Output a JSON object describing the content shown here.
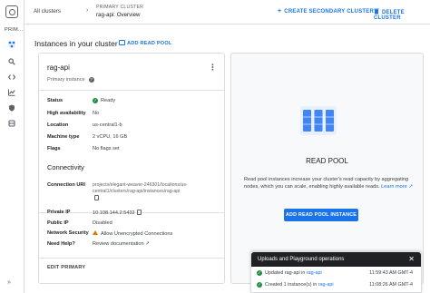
{
  "rail": {
    "section_label": "PRIM...",
    "icons": [
      "overview-icon",
      "query-icon",
      "code-icon",
      "monitoring-icon",
      "security-icon",
      "backups-icon"
    ],
    "expand_glyph": "»"
  },
  "header": {
    "breadcrumb": "All clusters",
    "chevron": "›",
    "cluster_type": "PRIMARY CLUSTER",
    "cluster_name": "rag-api: Overview",
    "create_secondary": "CREATE SECONDARY CLUSTER",
    "delete_cluster": "DELETE CLUSTER"
  },
  "instances": {
    "title": "Instances in your cluster",
    "add_read_pool": "ADD READ POOL"
  },
  "primary": {
    "name": "rag-api",
    "role": "Primary instance",
    "help": "?",
    "menu_glyph": "⋮",
    "rows": [
      {
        "label": "Status",
        "value": "Ready"
      },
      {
        "label": "High availability",
        "value": "No"
      },
      {
        "label": "Location",
        "value": "us-central1-b"
      },
      {
        "label": "Machine type",
        "value": "2 vCPU, 16 GB"
      },
      {
        "label": "Flags",
        "value": "No flags set"
      }
    ],
    "connectivity_title": "Connectivity",
    "connection_uri_label": "Connection URI",
    "connection_uri": "projects/elegant-weaver-246301/locations/us-central1/clusters/rag-api/instances/rag-api",
    "private_ip_label": "Private IP",
    "private_ip": "10.108.144.2:5432",
    "public_ip_label": "Public IP",
    "public_ip": "Disabled",
    "network_security_label": "Network Security",
    "network_security": "Allow Unencrypted Connections",
    "need_help_label": "Need Help?",
    "need_help_link": "Review documentation",
    "edit": "EDIT PRIMARY"
  },
  "read_pool": {
    "title": "READ POOL",
    "description": "Read pool instances increase your cluster's read capacity by aggregating nodes, which you can scale, enabling highly available reads.",
    "learn_more": "Learn more",
    "button": "ADD READ POOL INSTANCE"
  },
  "operations": {
    "title": "Uploads and Playground operations",
    "close": "✕",
    "items": [
      {
        "text": "Updated rag-api in",
        "link": "rag-api",
        "time": "11:59:43 AM GMT-4"
      },
      {
        "text": "Created 1 instance(s) in",
        "link": "rag-api",
        "time": "11:08:26 AM GMT-4"
      }
    ]
  },
  "colors": {
    "accent": "#1a73e8",
    "success": "#1e8e3e",
    "warning": "#e37400"
  }
}
